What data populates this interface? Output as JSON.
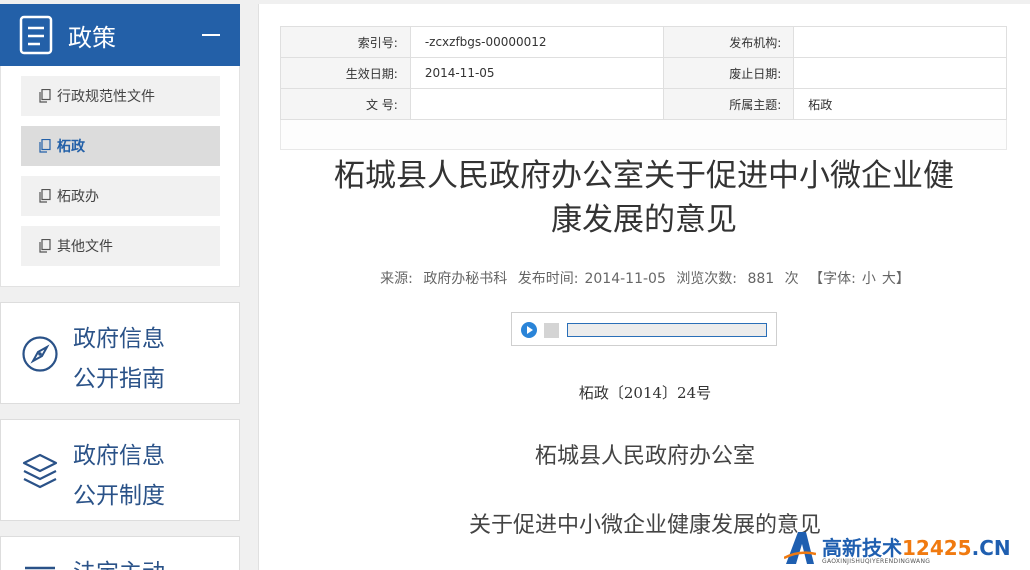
{
  "sidebar": {
    "title": "政策",
    "items": [
      {
        "label": "行政规范性文件",
        "active": false
      },
      {
        "label": "柘政",
        "active": true
      },
      {
        "label": "柘政办",
        "active": false
      },
      {
        "label": "其他文件",
        "active": false
      }
    ],
    "cards": [
      {
        "line1": "政府信息",
        "line2": "公开指南",
        "icon": "compass-icon"
      },
      {
        "line1": "政府信息",
        "line2": "公开制度",
        "icon": "layers-icon"
      },
      {
        "line1": "法定主动",
        "icon": "list-icon"
      }
    ],
    "accent": "#2360a8"
  },
  "meta": {
    "index_label": "索引号:",
    "index_value": "-zcxzfbgs-00000012",
    "publisher_label": "发布机构:",
    "publisher_value": "",
    "effective_label": "生效日期:",
    "effective_value": "2014-11-05",
    "repeal_label": "废止日期:",
    "repeal_value": "",
    "docno_label": "文 号:",
    "docno_value": "",
    "topic_label": "所属主题:",
    "topic_value": "柘政"
  },
  "article": {
    "title_line1": "柘城县人民政府办公室关于促进中小微企业健",
    "title_line2": "康发展的意见",
    "source_label": "来源:",
    "source_value": "政府办秘书科",
    "date_label": "发布时间:",
    "date_value": "2014-11-05",
    "views_label": "浏览次数:",
    "views_value": "881",
    "views_unit": "次",
    "font_label": "【字体:",
    "font_small": "小",
    "font_large": "大】",
    "doc_number": "柘政〔2014〕24号",
    "issuer": "柘城县人民政府办公室",
    "subtitle": "关于促进中小微企业健康发展的意见"
  },
  "watermark": {
    "main": "高新技术",
    "num": "12425",
    "suffix": ".CN",
    "sub": "GAOXINJISHUQIYERENDINGWANG"
  }
}
